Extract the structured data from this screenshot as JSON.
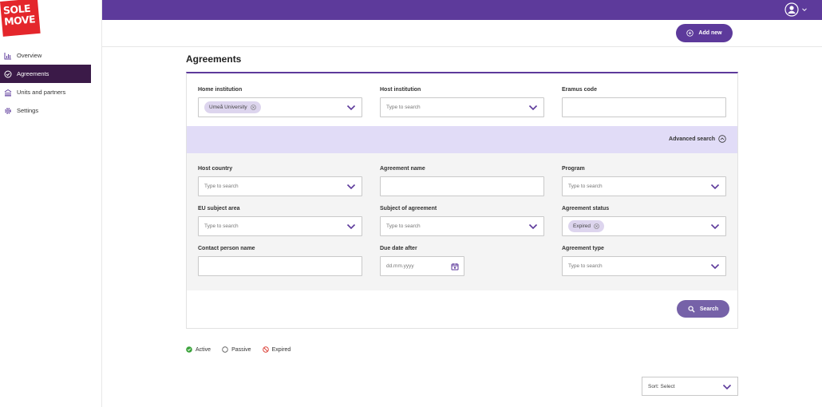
{
  "brand": {
    "logo_line1": "SOLE",
    "logo_line2": "MOVE"
  },
  "sidebar": {
    "items": [
      {
        "label": "Overview",
        "icon": "chart-icon",
        "active": false
      },
      {
        "label": "Agreements",
        "icon": "check-circle-icon",
        "active": true
      },
      {
        "label": "Units and partners",
        "icon": "building-icon",
        "active": false
      },
      {
        "label": "Settings",
        "icon": "gear-icon",
        "active": false
      }
    ]
  },
  "header": {
    "add_label": "Add new"
  },
  "page": {
    "title": "Agreements"
  },
  "search": {
    "home_institution": {
      "label": "Home institution",
      "chip": "Umeå University"
    },
    "host_institution": {
      "label": "Host institution",
      "placeholder": "Type to search"
    },
    "erasmus_code": {
      "label": "Eramus code",
      "value": ""
    },
    "advanced_label": "Advanced search",
    "host_country": {
      "label": "Host country",
      "placeholder": "Type to search"
    },
    "agreement_name": {
      "label": "Agreement name",
      "value": ""
    },
    "program": {
      "label": "Program",
      "placeholder": "Type to search"
    },
    "eu_subject_area": {
      "label": "EU subject area",
      "placeholder": "Type to search"
    },
    "subject_of_agreement": {
      "label": "Subject of agreement",
      "placeholder": "Type to search"
    },
    "agreement_status": {
      "label": "Agreement status",
      "chip": "Expired"
    },
    "contact_person_name": {
      "label": "Contact person name",
      "value": ""
    },
    "due_date_after": {
      "label": "Due date after",
      "placeholder": "dd.mm.yyyy"
    },
    "agreement_type": {
      "label": "Agreement type",
      "placeholder": "Type to search"
    },
    "search_label": "Search"
  },
  "legend": {
    "active": "Active",
    "passive": "Passive",
    "expired": "Expired"
  },
  "sort": {
    "label": "Sort: Select"
  },
  "colors": {
    "accent": "#5d3a9b",
    "sidebar_active": "#3b1a48",
    "advanced_band": "#e1dcf7",
    "logo": "#e4262b"
  }
}
